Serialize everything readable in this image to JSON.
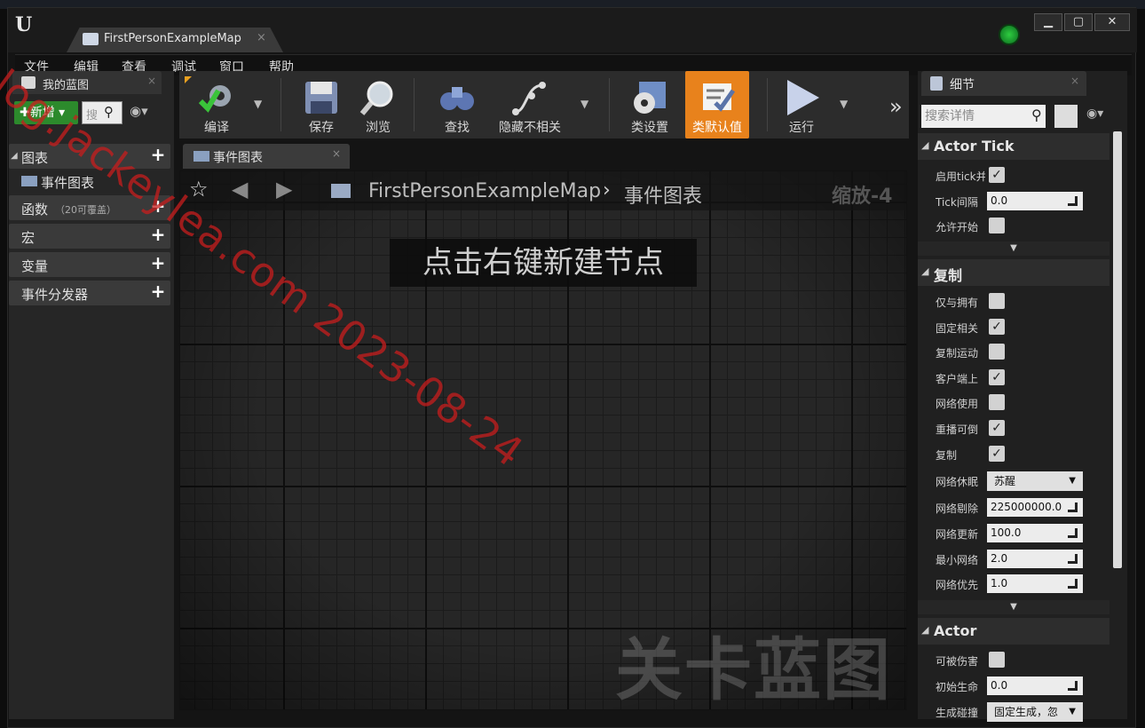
{
  "window": {
    "doc_tab_label": "FirstPersonExampleMap",
    "min": "▁",
    "max": "▢",
    "close": "✕"
  },
  "menu": [
    "文件",
    "编辑",
    "查看",
    "调试",
    "窗口",
    "帮助"
  ],
  "left_panel": {
    "tab_label": "我的蓝图",
    "add_label": "新增",
    "search_placeholder": "搜",
    "categories": {
      "graphs": "图表",
      "event_graph_item": "事件图表",
      "functions": "函数",
      "functions_note": "（20可覆盖）",
      "macros": "宏",
      "variables": "变量",
      "dispatchers": "事件分发器"
    }
  },
  "toolbar": {
    "compile": "编译",
    "save": "保存",
    "browse": "浏览",
    "find": "查找",
    "hide_unrelated": "隐藏不相关",
    "class_settings": "类设置",
    "class_defaults": "类默认值",
    "play": "运行",
    "more": "»",
    "accent": "#e8821c"
  },
  "graph": {
    "tab_label": "事件图表",
    "breadcrumb_root": "FirstPersonExampleMap",
    "breadcrumb_current": "事件图表",
    "zoom": "缩放-4",
    "hint": "点击右键新建节点",
    "watermark": "关卡蓝图"
  },
  "overlay_text": "blog.jackeylea.com 2023-08-24",
  "details": {
    "tab_label": "细节",
    "search_placeholder": "搜索详情",
    "sections": {
      "actor_tick": {
        "title": "Actor Tick",
        "rows": [
          {
            "label": "启用tick并",
            "checked": true
          },
          {
            "label": "Tick间隔",
            "value": "0.0"
          },
          {
            "label": "允许开始",
            "checked": false
          }
        ]
      },
      "replication": {
        "title": "复制",
        "rows": [
          {
            "label": "仅与拥有",
            "checked": false
          },
          {
            "label": "固定相关",
            "checked": true
          },
          {
            "label": "复制运动",
            "checked": false
          },
          {
            "label": "客户端上",
            "checked": true
          },
          {
            "label": "网络使用",
            "checked": false
          },
          {
            "label": "重播可倒",
            "checked": true
          },
          {
            "label": "复制",
            "checked": true
          },
          {
            "label": "网络休眠",
            "select": "苏醒"
          },
          {
            "label": "网络剔除",
            "value": "225000000.0"
          },
          {
            "label": "网络更新",
            "value": "100.0"
          },
          {
            "label": "最小网络",
            "value": "2.0"
          },
          {
            "label": "网络优先",
            "value": "1.0"
          }
        ]
      },
      "actor": {
        "title": "Actor",
        "rows": [
          {
            "label": "可被伤害",
            "checked": false
          },
          {
            "label": "初始生命",
            "value": "0.0"
          },
          {
            "label": "生成碰撞",
            "select": "固定生成，忽"
          }
        ]
      }
    }
  }
}
